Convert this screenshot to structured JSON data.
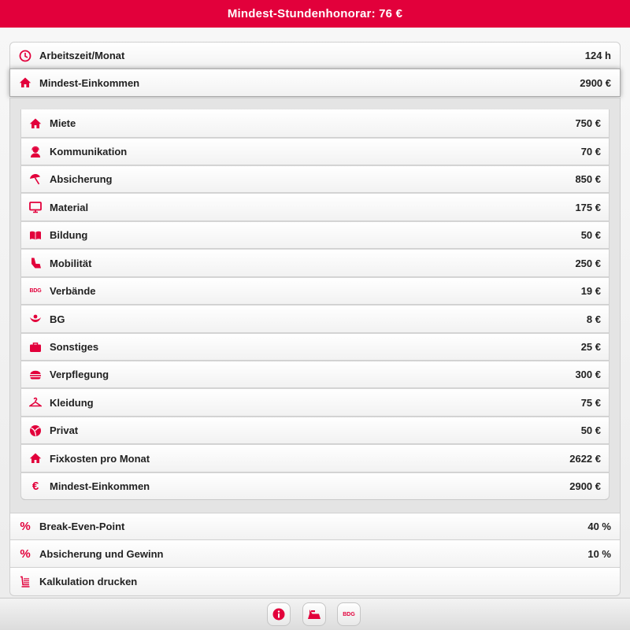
{
  "header": {
    "title": "Mindest-Stundenhonorar: 76 €"
  },
  "rows_top": [
    {
      "label": "Arbeitszeit/Monat",
      "value": "124 h",
      "icon": "clock-icon"
    },
    {
      "label": "Mindest-Einkommen",
      "value": "2900 €",
      "icon": "house-icon"
    }
  ],
  "breakdown": [
    {
      "label": "Miete",
      "value": "750 €",
      "icon": "house-icon"
    },
    {
      "label": "Kommunikation",
      "value": "70 €",
      "icon": "person-headset-icon"
    },
    {
      "label": "Absicherung",
      "value": "850 €",
      "icon": "umbrella-icon"
    },
    {
      "label": "Material",
      "value": "175 €",
      "icon": "monitor-icon"
    },
    {
      "label": "Bildung",
      "value": "50 €",
      "icon": "book-icon"
    },
    {
      "label": "Mobilität",
      "value": "250 €",
      "icon": "car-seat-icon"
    },
    {
      "label": "Verbände",
      "value": "19 €",
      "icon": "bdg-logo-icon",
      "icon_text": "BDG"
    },
    {
      "label": "BG",
      "value": "8 €",
      "icon": "hands-icon"
    },
    {
      "label": "Sonstiges",
      "value": "25 €",
      "icon": "briefcase-icon"
    },
    {
      "label": "Verpflegung",
      "value": "300 €",
      "icon": "burger-icon"
    },
    {
      "label": "Kleidung",
      "value": "75 €",
      "icon": "hanger-icon"
    },
    {
      "label": "Privat",
      "value": "50 €",
      "icon": "beach-ball-icon"
    },
    {
      "label": "Fixkosten pro Monat",
      "value": "2622 €",
      "icon": "house-icon"
    },
    {
      "label": "Mindest-Einkommen",
      "value": "2900 €",
      "icon": "euro-icon"
    }
  ],
  "rows_bottom": [
    {
      "label": "Break-Even-Point",
      "value": "40 %",
      "icon": "percent-icon"
    },
    {
      "label": "Absicherung und Gewinn",
      "value": "10 %",
      "icon": "percent-icon"
    },
    {
      "label": "Kalkulation drucken",
      "value": "",
      "icon": "print-list-icon"
    }
  ],
  "footer": {
    "buttons": [
      {
        "name": "info-button",
        "icon": "info-icon"
      },
      {
        "name": "calculator-button",
        "icon": "cash-register-icon"
      },
      {
        "name": "bdg-button",
        "icon": "bdg-logo-icon",
        "icon_text": "BDG"
      }
    ]
  },
  "colors": {
    "accent": "#e2003b",
    "background": "#e6e6e6"
  }
}
